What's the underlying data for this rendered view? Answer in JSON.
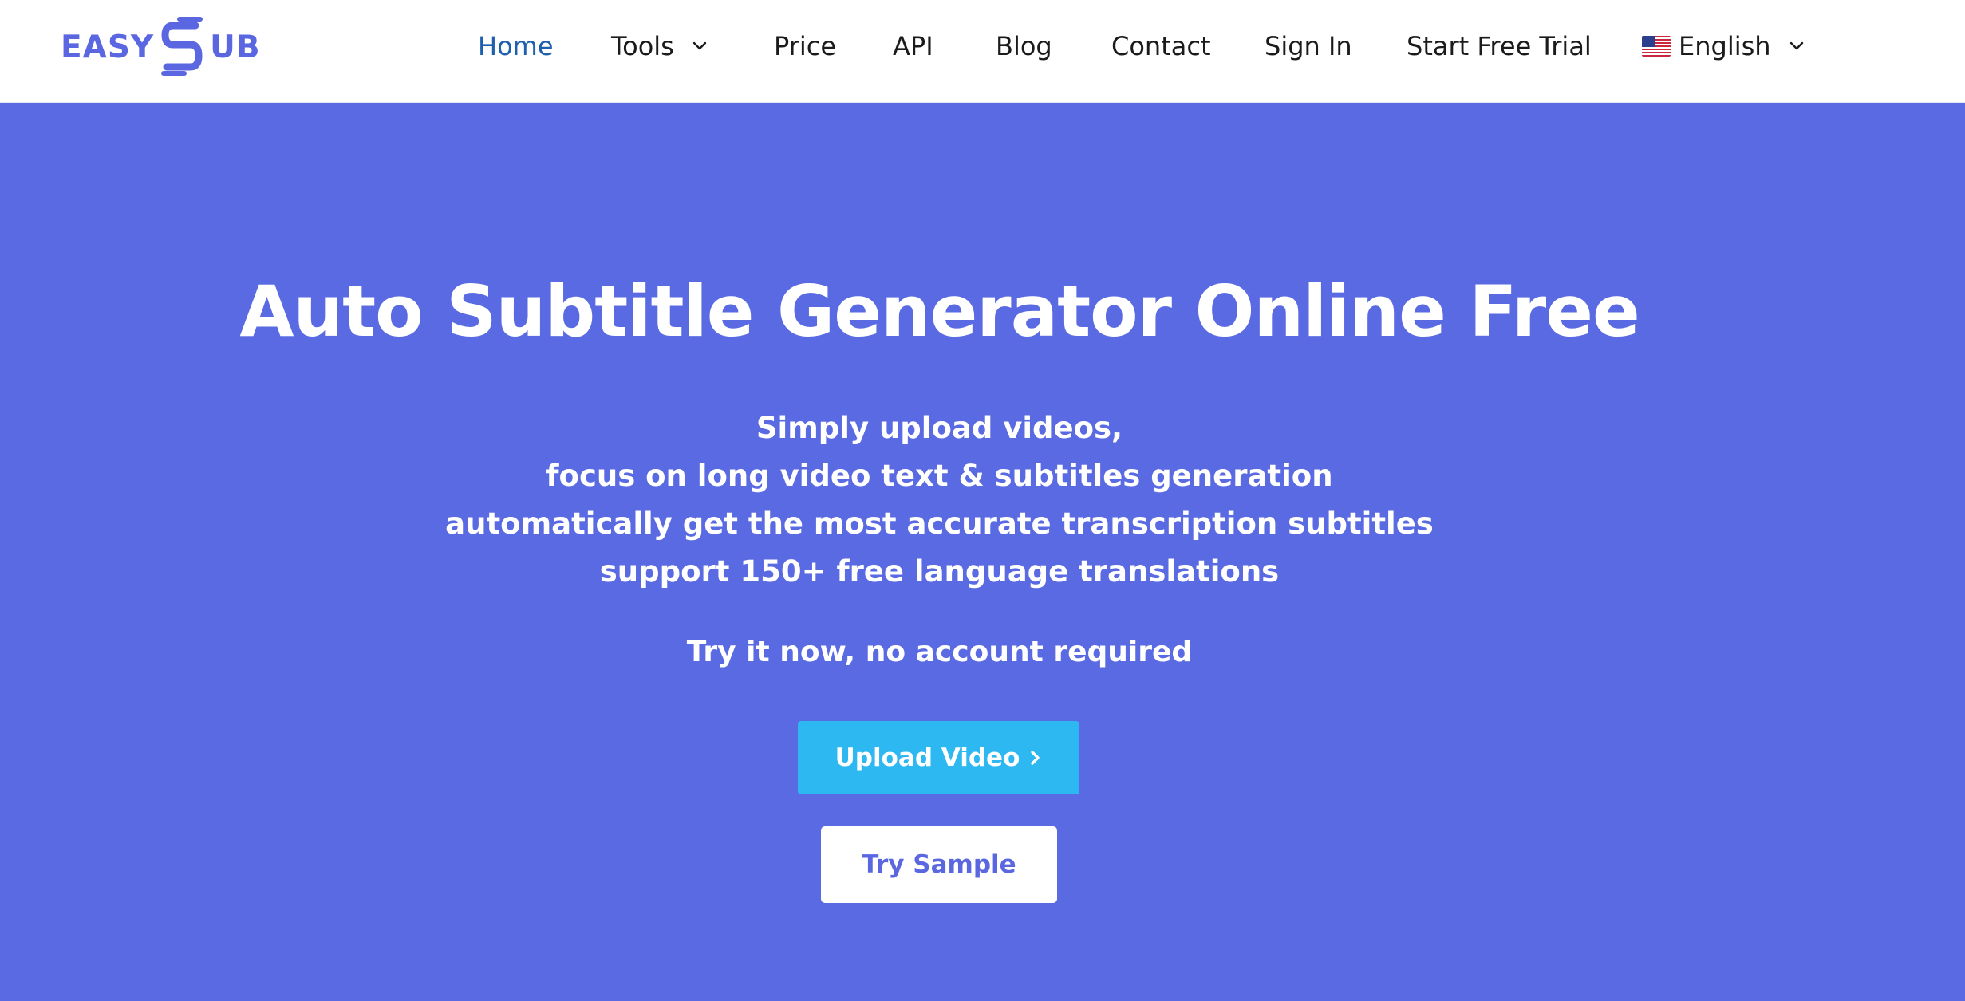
{
  "brand": {
    "logo_left": "EASY",
    "logo_right": "UB",
    "color": "#5a67e0"
  },
  "nav": {
    "items": [
      {
        "label": "Home",
        "active": true
      },
      {
        "label": "Tools",
        "has_dropdown": true
      },
      {
        "label": "Price"
      },
      {
        "label": "API"
      },
      {
        "label": "Blog"
      },
      {
        "label": "Contact"
      },
      {
        "label": "Sign In"
      },
      {
        "label": "Start Free Trial"
      }
    ],
    "language": {
      "label": "English",
      "flag_icon": "us-flag-icon",
      "has_dropdown": true
    },
    "active_color": "#1e5fae"
  },
  "hero": {
    "background": "#5a6ae2",
    "title": "Auto Subtitle Generator Online Free",
    "lines": [
      "Simply upload videos,",
      "focus on long video text & subtitles generation",
      "automatically get the most accurate transcription subtitles",
      "support 150+ free language translations"
    ],
    "note": "Try it now, no account required",
    "upload_button": {
      "label": "Upload Video",
      "icon": "chevron-right-icon",
      "color": "#2db8f2"
    },
    "sample_button": {
      "label": "Try Sample"
    }
  }
}
